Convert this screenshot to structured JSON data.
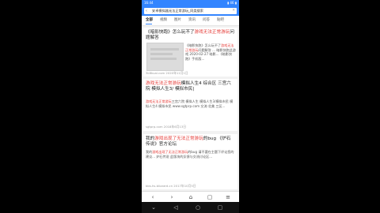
{
  "status": {
    "time": "16:44",
    "icons": "▮ 46  ▮"
  },
  "search": {
    "back_icon": "chevron-left",
    "query": "安卓模拟器无法正常游玩_同类搜索",
    "clear_icon": "close"
  },
  "tabs": [
    {
      "label": "全部",
      "active": true
    },
    {
      "label": "视频"
    },
    {
      "label": "图片"
    },
    {
      "label": "资讯"
    },
    {
      "label": "问答"
    },
    {
      "label": "贴吧"
    }
  ],
  "results": [
    {
      "title_a": "《暗影快跑》怎么玩不了",
      "title_hl": "游戏无法正常游玩",
      "title_b": "问题解答",
      "snippet_a": "《暗影快跑》怎么玩不了",
      "snippet_hl": "游戏无法正常游玩",
      "snippet_b": "问题解答 ... 暗影快跑此游戏 2020-02-27 暗影...《暗影快跑》手机版...",
      "meta": "3k8kuai.com   2020年11月1日"
    },
    {
      "title_hl": "游戏无法正常游玩",
      "title_a": "模拟人生4 综合区 三宫六院 模拟人生3/ 模拟市民|",
      "snippet_hl": "游戏无法正常游玩",
      "snippet_b": "三宫六院 模拟人生 模拟人生3/模拟市民 模拟人生4 模拟市民 www.sgtprp.com 交流·北美 三区...",
      "meta": "sgtprp.com   2018年6月13日"
    },
    {
      "title_a": "我的",
      "title_hl": "游戏出现了无法正常游玩",
      "title_b": "的bug 《炉石传说》官方论坛",
      "snippet_a": "我的",
      "snippet_hl": "游戏出现了无法正常游玩",
      "snippet_b": "的bug 请不要在主题下评论您的建议... 炉石传说 此版块的反馈与交流讨论区...",
      "meta": "bbs.hs.blizzard.cn   2017年10月5日"
    }
  ],
  "bottom_nav": [
    "‹",
    "›",
    "⌂",
    "▢",
    "≡"
  ],
  "system_nav": [
    "⌄",
    "◁",
    "○",
    "▢"
  ]
}
